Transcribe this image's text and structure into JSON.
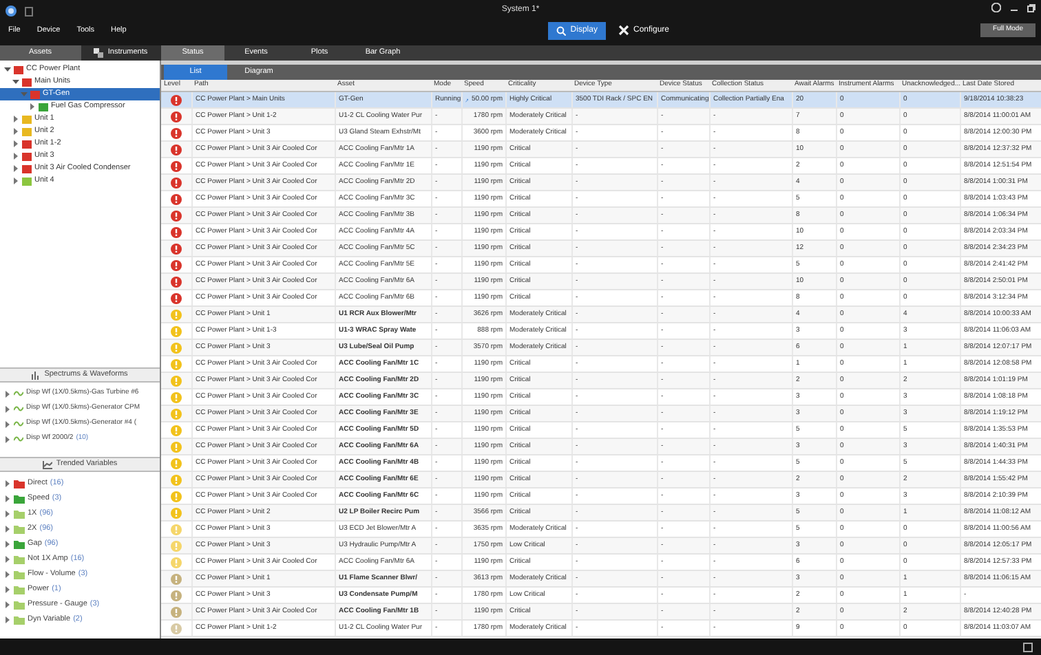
{
  "window": {
    "title": "System 1*"
  },
  "menu": [
    "File",
    "Device",
    "Tools",
    "Help"
  ],
  "modes": [
    {
      "label": "Display",
      "selected": true,
      "kind": "display"
    },
    {
      "label": "Configure",
      "selected": false,
      "kind": "configure"
    }
  ],
  "full_mode_button": "Full Mode",
  "left_tabs": [
    {
      "label": "Assets",
      "selected": true
    },
    {
      "label": "Instruments",
      "selected": false
    }
  ],
  "main_tabs": [
    {
      "label": "Status",
      "selected": true
    },
    {
      "label": "Events",
      "selected": false
    },
    {
      "label": "Plots",
      "selected": false
    },
    {
      "label": "Bar Graph",
      "selected": false
    }
  ],
  "view_tabs": [
    {
      "label": "List",
      "selected": true
    },
    {
      "label": "Diagram",
      "selected": false
    }
  ],
  "tree": [
    {
      "label": "CC Power Plant",
      "color": "#d9342b",
      "expanded": true,
      "selected": false,
      "children": [
        {
          "label": "Main Units",
          "color": "#d9342b",
          "expanded": true,
          "selected": false,
          "children": [
            {
              "label": "GT-Gen",
              "color": "#d9342b",
              "expanded": true,
              "selected": true,
              "children": [
                {
                  "label": "Fuel Gas Compressor",
                  "color": "#3aa53a",
                  "expanded": false,
                  "selected": false
                }
              ]
            }
          ]
        },
        {
          "label": "Unit 1",
          "color": "#e8b820",
          "expanded": false,
          "selected": false
        },
        {
          "label": "Unit 2",
          "color": "#e8b820",
          "expanded": false,
          "selected": false
        },
        {
          "label": "Unit 1-2",
          "color": "#d9342b",
          "expanded": false,
          "selected": false
        },
        {
          "label": "Unit 3",
          "color": "#d9342b",
          "expanded": false,
          "selected": false
        },
        {
          "label": "Unit 3 Air Cooled Condenser",
          "color": "#d9342b",
          "expanded": false,
          "selected": false
        },
        {
          "label": "Unit 4",
          "color": "#8cc63f",
          "expanded": false,
          "selected": false
        }
      ]
    }
  ],
  "spectrums": {
    "title": "Spectrums & Waveforms",
    "items": [
      {
        "label": "Disp Wf (1X/0.5kms)-Gas Turbine #6"
      },
      {
        "label": "Disp Wf (1X/0.5kms)-Generator CPM"
      },
      {
        "label": "Disp Wf (1X/0.5kms)-Generator #4 ("
      },
      {
        "label": "Disp Wf 2000/2",
        "count": "(10)"
      }
    ]
  },
  "trended": {
    "title": "Trended Variables",
    "items": [
      {
        "label": "Direct",
        "count": "(16)",
        "color": "#d9342b"
      },
      {
        "label": "Speed",
        "count": "(3)",
        "color": "#3aa53a"
      },
      {
        "label": "1X",
        "count": "(96)",
        "color": "#a6cf6a"
      },
      {
        "label": "2X",
        "count": "(96)",
        "color": "#a6cf6a"
      },
      {
        "label": "Gap",
        "count": "(96)",
        "color": "#3aa53a"
      },
      {
        "label": "Not 1X Amp",
        "count": "(16)",
        "color": "#a6cf6a"
      },
      {
        "label": "Flow - Volume",
        "count": "(3)",
        "color": "#a6cf6a"
      },
      {
        "label": "Power",
        "count": "(1)",
        "color": "#a6cf6a"
      },
      {
        "label": "Pressure - Gauge",
        "count": "(3)",
        "color": "#a6cf6a"
      },
      {
        "label": "Dyn Variable",
        "count": "(2)",
        "color": "#a6cf6a"
      }
    ]
  },
  "table": {
    "columns": [
      "Level",
      "Path",
      "Asset",
      "Mode",
      "Speed",
      "Criticality",
      "Device Type",
      "Device Status",
      "Collection Status",
      "Await Alarms",
      "Instrument Alarms",
      "Unacknowledged...",
      "Last Date Stored"
    ],
    "rows": [
      {
        "color": "#d9342b",
        "selected": true,
        "path": "CC Power Plant > Main Units",
        "asset": "GT-Gen",
        "bold": false,
        "mode": "Running",
        "speed": "50.00 rpm",
        "criticality": "Highly Critical",
        "device_type": "3500 TDI Rack / SPC EN",
        "device_status": "Communicating",
        "collection_status": "Collection Partially Ena",
        "await": "20",
        "instrument": "0",
        "unack": "0",
        "date": "9/18/2014 10:38:23"
      },
      {
        "color": "#d9342b",
        "selected": false,
        "path": "CC Power Plant > Unit 1-2",
        "asset": "U1-2 CL Cooling Water Pur",
        "bold": false,
        "mode": "-",
        "speed": "1780 rpm",
        "criticality": "Moderately Critical",
        "device_type": "-",
        "device_status": "-",
        "collection_status": "-",
        "await": "7",
        "instrument": "0",
        "unack": "0",
        "date": "8/8/2014 11:00:01 AM"
      },
      {
        "color": "#d9342b",
        "selected": false,
        "path": "CC Power Plant > Unit 3",
        "asset": "U3 Gland Steam Exhstr/Mt",
        "bold": false,
        "mode": "-",
        "speed": "3600 rpm",
        "criticality": "Moderately Critical",
        "device_type": "-",
        "device_status": "-",
        "collection_status": "-",
        "await": "8",
        "instrument": "0",
        "unack": "0",
        "date": "8/8/2014 12:00:30 PM"
      },
      {
        "color": "#d9342b",
        "selected": false,
        "path": "CC Power Plant > Unit 3 Air Cooled Cor",
        "asset": "ACC Cooling Fan/Mtr 1A",
        "bold": false,
        "mode": "-",
        "speed": "1190 rpm",
        "criticality": "Critical",
        "device_type": "-",
        "device_status": "-",
        "collection_status": "-",
        "await": "10",
        "instrument": "0",
        "unack": "0",
        "date": "8/8/2014 12:37:32 PM"
      },
      {
        "color": "#d9342b",
        "selected": false,
        "path": "CC Power Plant > Unit 3 Air Cooled Cor",
        "asset": "ACC Cooling Fan/Mtr 1E",
        "bold": false,
        "mode": "-",
        "speed": "1190 rpm",
        "criticality": "Critical",
        "device_type": "-",
        "device_status": "-",
        "collection_status": "-",
        "await": "2",
        "instrument": "0",
        "unack": "0",
        "date": "8/8/2014 12:51:54 PM"
      },
      {
        "color": "#d9342b",
        "selected": false,
        "path": "CC Power Plant > Unit 3 Air Cooled Cor",
        "asset": "ACC Cooling Fan/Mtr 2D",
        "bold": false,
        "mode": "-",
        "speed": "1190 rpm",
        "criticality": "Critical",
        "device_type": "-",
        "device_status": "-",
        "collection_status": "-",
        "await": "4",
        "instrument": "0",
        "unack": "0",
        "date": "8/8/2014 1:00:31 PM"
      },
      {
        "color": "#d9342b",
        "selected": false,
        "path": "CC Power Plant > Unit 3 Air Cooled Cor",
        "asset": "ACC Cooling Fan/Mtr 3C",
        "bold": false,
        "mode": "-",
        "speed": "1190 rpm",
        "criticality": "Critical",
        "device_type": "-",
        "device_status": "-",
        "collection_status": "-",
        "await": "5",
        "instrument": "0",
        "unack": "0",
        "date": "8/8/2014 1:03:43 PM"
      },
      {
        "color": "#d9342b",
        "selected": false,
        "path": "CC Power Plant > Unit 3 Air Cooled Cor",
        "asset": "ACC Cooling Fan/Mtr 3B",
        "bold": false,
        "mode": "-",
        "speed": "1190 rpm",
        "criticality": "Critical",
        "device_type": "-",
        "device_status": "-",
        "collection_status": "-",
        "await": "8",
        "instrument": "0",
        "unack": "0",
        "date": "8/8/2014 1:06:34 PM"
      },
      {
        "color": "#d9342b",
        "selected": false,
        "path": "CC Power Plant > Unit 3 Air Cooled Cor",
        "asset": "ACC Cooling Fan/Mtr 4A",
        "bold": false,
        "mode": "-",
        "speed": "1190 rpm",
        "criticality": "Critical",
        "device_type": "-",
        "device_status": "-",
        "collection_status": "-",
        "await": "10",
        "instrument": "0",
        "unack": "0",
        "date": "8/8/2014 2:03:34 PM"
      },
      {
        "color": "#d9342b",
        "selected": false,
        "path": "CC Power Plant > Unit 3 Air Cooled Cor",
        "asset": "ACC Cooling Fan/Mtr 5C",
        "bold": false,
        "mode": "-",
        "speed": "1190 rpm",
        "criticality": "Critical",
        "device_type": "-",
        "device_status": "-",
        "collection_status": "-",
        "await": "12",
        "instrument": "0",
        "unack": "0",
        "date": "8/8/2014 2:34:23 PM"
      },
      {
        "color": "#d9342b",
        "selected": false,
        "path": "CC Power Plant > Unit 3 Air Cooled Cor",
        "asset": "ACC Cooling Fan/Mtr 5E",
        "bold": false,
        "mode": "-",
        "speed": "1190 rpm",
        "criticality": "Critical",
        "device_type": "-",
        "device_status": "-",
        "collection_status": "-",
        "await": "5",
        "instrument": "0",
        "unack": "0",
        "date": "8/8/2014 2:41:42 PM"
      },
      {
        "color": "#d9342b",
        "selected": false,
        "path": "CC Power Plant > Unit 3 Air Cooled Cor",
        "asset": "ACC Cooling Fan/Mtr 6A",
        "bold": false,
        "mode": "-",
        "speed": "1190 rpm",
        "criticality": "Critical",
        "device_type": "-",
        "device_status": "-",
        "collection_status": "-",
        "await": "10",
        "instrument": "0",
        "unack": "0",
        "date": "8/8/2014 2:50:01 PM"
      },
      {
        "color": "#d9342b",
        "selected": false,
        "path": "CC Power Plant > Unit 3 Air Cooled Cor",
        "asset": "ACC Cooling Fan/Mtr 6B",
        "bold": false,
        "mode": "-",
        "speed": "1190 rpm",
        "criticality": "Critical",
        "device_type": "-",
        "device_status": "-",
        "collection_status": "-",
        "await": "8",
        "instrument": "0",
        "unack": "0",
        "date": "8/8/2014 3:12:34 PM"
      },
      {
        "color": "#f2c21b",
        "selected": false,
        "path": "CC Power Plant > Unit 1",
        "asset": "U1 RCR Aux Blower/Mtr",
        "bold": true,
        "mode": "-",
        "speed": "3626 rpm",
        "criticality": "Moderately Critical",
        "device_type": "-",
        "device_status": "-",
        "collection_status": "-",
        "await": "4",
        "instrument": "0",
        "unack": "4",
        "date": "8/8/2014 10:00:33 AM"
      },
      {
        "color": "#f2c21b",
        "selected": false,
        "path": "CC Power Plant > Unit 1-3",
        "asset": "U1-3 WRAC Spray Wate",
        "bold": true,
        "mode": "-",
        "speed": "888 rpm",
        "criticality": "Moderately Critical",
        "device_type": "-",
        "device_status": "-",
        "collection_status": "-",
        "await": "3",
        "instrument": "0",
        "unack": "3",
        "date": "8/8/2014 11:06:03 AM"
      },
      {
        "color": "#f2c21b",
        "selected": false,
        "path": "CC Power Plant > Unit 3",
        "asset": "U3 Lube/Seal Oil Pump",
        "bold": true,
        "mode": "-",
        "speed": "3570 rpm",
        "criticality": "Moderately Critical",
        "device_type": "-",
        "device_status": "-",
        "collection_status": "-",
        "await": "6",
        "instrument": "0",
        "unack": "1",
        "date": "8/8/2014 12:07:17 PM"
      },
      {
        "color": "#f2c21b",
        "selected": false,
        "path": "CC Power Plant > Unit 3 Air Cooled Cor",
        "asset": "ACC Cooling Fan/Mtr 1C",
        "bold": true,
        "mode": "-",
        "speed": "1190 rpm",
        "criticality": "Critical",
        "device_type": "-",
        "device_status": "-",
        "collection_status": "-",
        "await": "1",
        "instrument": "0",
        "unack": "1",
        "date": "8/8/2014 12:08:58 PM"
      },
      {
        "color": "#f2c21b",
        "selected": false,
        "path": "CC Power Plant > Unit 3 Air Cooled Cor",
        "asset": "ACC Cooling Fan/Mtr 2D",
        "bold": true,
        "mode": "-",
        "speed": "1190 rpm",
        "criticality": "Critical",
        "device_type": "-",
        "device_status": "-",
        "collection_status": "-",
        "await": "2",
        "instrument": "0",
        "unack": "2",
        "date": "8/8/2014 1:01:19 PM"
      },
      {
        "color": "#f2c21b",
        "selected": false,
        "path": "CC Power Plant > Unit 3 Air Cooled Cor",
        "asset": "ACC Cooling Fan/Mtr 3C",
        "bold": true,
        "mode": "-",
        "speed": "1190 rpm",
        "criticality": "Critical",
        "device_type": "-",
        "device_status": "-",
        "collection_status": "-",
        "await": "3",
        "instrument": "0",
        "unack": "3",
        "date": "8/8/2014 1:08:18 PM"
      },
      {
        "color": "#f2c21b",
        "selected": false,
        "path": "CC Power Plant > Unit 3 Air Cooled Cor",
        "asset": "ACC Cooling Fan/Mtr 3E",
        "bold": true,
        "mode": "-",
        "speed": "1190 rpm",
        "criticality": "Critical",
        "device_type": "-",
        "device_status": "-",
        "collection_status": "-",
        "await": "3",
        "instrument": "0",
        "unack": "3",
        "date": "8/8/2014 1:19:12 PM"
      },
      {
        "color": "#f2c21b",
        "selected": false,
        "path": "CC Power Plant > Unit 3 Air Cooled Cor",
        "asset": "ACC Cooling Fan/Mtr 5D",
        "bold": true,
        "mode": "-",
        "speed": "1190 rpm",
        "criticality": "Critical",
        "device_type": "-",
        "device_status": "-",
        "collection_status": "-",
        "await": "5",
        "instrument": "0",
        "unack": "5",
        "date": "8/8/2014 1:35:53 PM"
      },
      {
        "color": "#f2c21b",
        "selected": false,
        "path": "CC Power Plant > Unit 3 Air Cooled Cor",
        "asset": "ACC Cooling Fan/Mtr 6A",
        "bold": true,
        "mode": "-",
        "speed": "1190 rpm",
        "criticality": "Critical",
        "device_type": "-",
        "device_status": "-",
        "collection_status": "-",
        "await": "3",
        "instrument": "0",
        "unack": "3",
        "date": "8/8/2014 1:40:31 PM"
      },
      {
        "color": "#f2c21b",
        "selected": false,
        "path": "CC Power Plant > Unit 3 Air Cooled Cor",
        "asset": "ACC Cooling Fan/Mtr 4B",
        "bold": true,
        "mode": "-",
        "speed": "1190 rpm",
        "criticality": "Critical",
        "device_type": "-",
        "device_status": "-",
        "collection_status": "-",
        "await": "5",
        "instrument": "0",
        "unack": "5",
        "date": "8/8/2014 1:44:33 PM"
      },
      {
        "color": "#f2c21b",
        "selected": false,
        "path": "CC Power Plant > Unit 3 Air Cooled Cor",
        "asset": "ACC Cooling Fan/Mtr 6E",
        "bold": true,
        "mode": "-",
        "speed": "1190 rpm",
        "criticality": "Critical",
        "device_type": "-",
        "device_status": "-",
        "collection_status": "-",
        "await": "2",
        "instrument": "0",
        "unack": "2",
        "date": "8/8/2014 1:55:42 PM"
      },
      {
        "color": "#f2c21b",
        "selected": false,
        "path": "CC Power Plant > Unit 3 Air Cooled Cor",
        "asset": "ACC Cooling Fan/Mtr 6C",
        "bold": true,
        "mode": "-",
        "speed": "1190 rpm",
        "criticality": "Critical",
        "device_type": "-",
        "device_status": "-",
        "collection_status": "-",
        "await": "3",
        "instrument": "0",
        "unack": "3",
        "date": "8/8/2014 2:10:39 PM"
      },
      {
        "color": "#f2c21b",
        "selected": false,
        "path": "CC Power Plant > Unit 2",
        "asset": "U2 LP Boiler Recirc Pum",
        "bold": true,
        "mode": "-",
        "speed": "3566 rpm",
        "criticality": "Critical",
        "device_type": "-",
        "device_status": "-",
        "collection_status": "-",
        "await": "5",
        "instrument": "0",
        "unack": "1",
        "date": "8/8/2014 11:08:12 AM"
      },
      {
        "color": "#f5d66a",
        "selected": false,
        "path": "CC Power Plant > Unit 3",
        "asset": "U3 ECD Jet Blower/Mtr A",
        "bold": false,
        "mode": "-",
        "speed": "3635 rpm",
        "criticality": "Moderately Critical",
        "device_type": "-",
        "device_status": "-",
        "collection_status": "-",
        "await": "5",
        "instrument": "0",
        "unack": "0",
        "date": "8/8/2014 11:00:56 AM"
      },
      {
        "color": "#f5d66a",
        "selected": false,
        "path": "CC Power Plant > Unit 3",
        "asset": "U3 Hydraulic Pump/Mtr A",
        "bold": false,
        "mode": "-",
        "speed": "1750 rpm",
        "criticality": "Low Critical",
        "device_type": "-",
        "device_status": "-",
        "collection_status": "-",
        "await": "3",
        "instrument": "0",
        "unack": "0",
        "date": "8/8/2014 12:05:17 PM"
      },
      {
        "color": "#f5d66a",
        "selected": false,
        "path": "CC Power Plant > Unit 3 Air Cooled Cor",
        "asset": "ACC Cooling Fan/Mtr 6A",
        "bold": false,
        "mode": "-",
        "speed": "1190 rpm",
        "criticality": "Critical",
        "device_type": "-",
        "device_status": "-",
        "collection_status": "-",
        "await": "6",
        "instrument": "0",
        "unack": "0",
        "date": "8/8/2014 12:57:33 PM"
      },
      {
        "color": "#c6b27e",
        "selected": false,
        "path": "CC Power Plant > Unit 1",
        "asset": "U1 Flame Scanner Blwr/",
        "bold": true,
        "mode": "-",
        "speed": "3613 rpm",
        "criticality": "Moderately Critical",
        "device_type": "-",
        "device_status": "-",
        "collection_status": "-",
        "await": "3",
        "instrument": "0",
        "unack": "1",
        "date": "8/8/2014 11:06:15 AM"
      },
      {
        "color": "#c6b27e",
        "selected": false,
        "path": "CC Power Plant > Unit 3",
        "asset": "U3 Condensate Pump/M",
        "bold": true,
        "mode": "-",
        "speed": "1780 rpm",
        "criticality": "Low Critical",
        "device_type": "-",
        "device_status": "-",
        "collection_status": "-",
        "await": "2",
        "instrument": "0",
        "unack": "1",
        "date": "-"
      },
      {
        "color": "#c6b27e",
        "selected": false,
        "path": "CC Power Plant > Unit 3 Air Cooled Cor",
        "asset": "ACC Cooling Fan/Mtr 1B",
        "bold": true,
        "mode": "-",
        "speed": "1190 rpm",
        "criticality": "Critical",
        "device_type": "-",
        "device_status": "-",
        "collection_status": "-",
        "await": "2",
        "instrument": "0",
        "unack": "2",
        "date": "8/8/2014 12:40:28 PM"
      },
      {
        "color": "#d8caa4",
        "selected": false,
        "path": "CC Power Plant > Unit 1-2",
        "asset": "U1-2 CL Cooling Water Pur",
        "bold": false,
        "mode": "-",
        "speed": "1780 rpm",
        "criticality": "Moderately Critical",
        "device_type": "-",
        "device_status": "-",
        "collection_status": "-",
        "await": "9",
        "instrument": "0",
        "unack": "0",
        "date": "8/8/2014 11:03:07 AM"
      }
    ]
  }
}
